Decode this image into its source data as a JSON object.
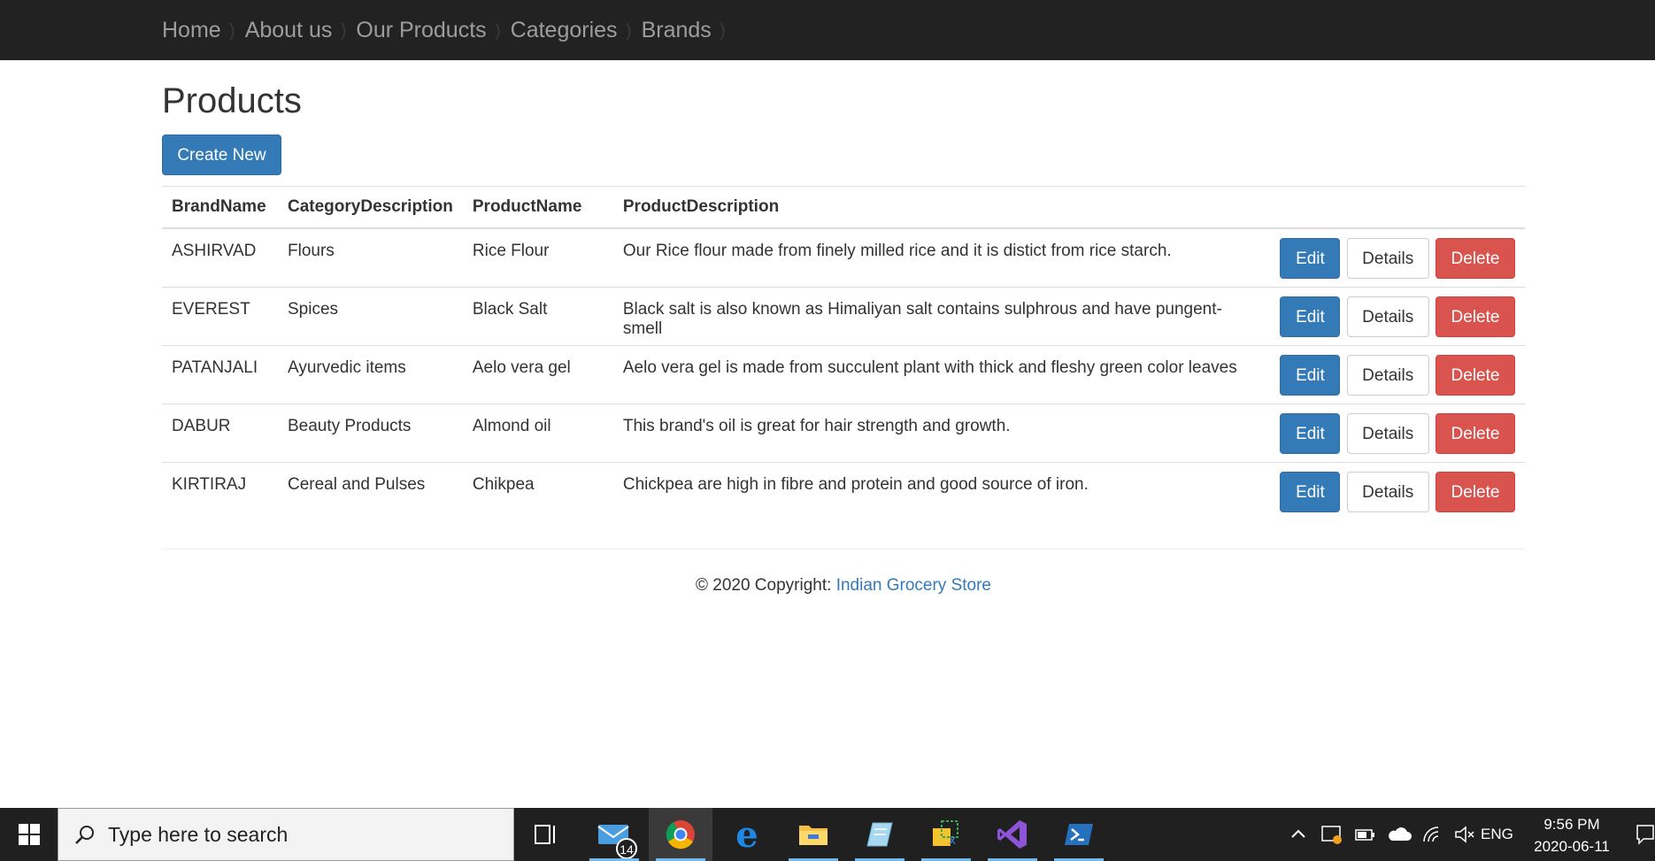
{
  "nav": {
    "items": [
      {
        "label": "Home"
      },
      {
        "label": "About us"
      },
      {
        "label": "Our Products"
      },
      {
        "label": "Categories"
      },
      {
        "label": "Brands"
      }
    ]
  },
  "page": {
    "title": "Products",
    "create_label": "Create New"
  },
  "table": {
    "headers": {
      "brand": "BrandName",
      "category": "CategoryDescription",
      "product": "ProductName",
      "description": "ProductDescription"
    },
    "rows": [
      {
        "brand": "ASHIRVAD",
        "category": "Flours",
        "product": "Rice Flour",
        "description": "Our Rice flour made from finely milled rice and it is distict from rice starch."
      },
      {
        "brand": "EVEREST",
        "category": "Spices",
        "product": "Black Salt",
        "description": "Black salt is also known as Himaliyan salt contains sulphrous and have pungent-smell"
      },
      {
        "brand": "PATANJALI",
        "category": "Ayurvedic items",
        "product": "Aelo vera gel",
        "description": "Aelo vera gel is made from succulent plant with thick and fleshy green color leaves"
      },
      {
        "brand": "DABUR",
        "category": "Beauty Products",
        "product": "Almond oil",
        "description": "This brand's oil is great for hair strength and growth."
      },
      {
        "brand": "KIRTIRAJ",
        "category": "Cereal and Pulses",
        "product": "Chikpea",
        "description": "Chickpea are high in fibre and protein and good source of iron."
      }
    ],
    "actions": {
      "edit": "Edit",
      "details": "Details",
      "delete": "Delete"
    }
  },
  "footer": {
    "text": "© 2020 Copyright: ",
    "link": "Indian Grocery Store"
  },
  "taskbar": {
    "search_placeholder": "Type here to search",
    "mail_badge": "14",
    "language": "ENG",
    "time": "9:56 PM",
    "date": "2020-06-11",
    "icons": [
      "windows-start-icon",
      "search-icon",
      "task-view-icon",
      "mail-icon",
      "chrome-icon",
      "edge-icon",
      "file-explorer-icon",
      "notepad-icon",
      "snipping-tool-icon",
      "visual-studio-icon",
      "powershell-icon"
    ]
  },
  "colors": {
    "navbar": "#222222",
    "primary": "#337ab7",
    "danger": "#d9534f",
    "taskbar": "#202020"
  }
}
